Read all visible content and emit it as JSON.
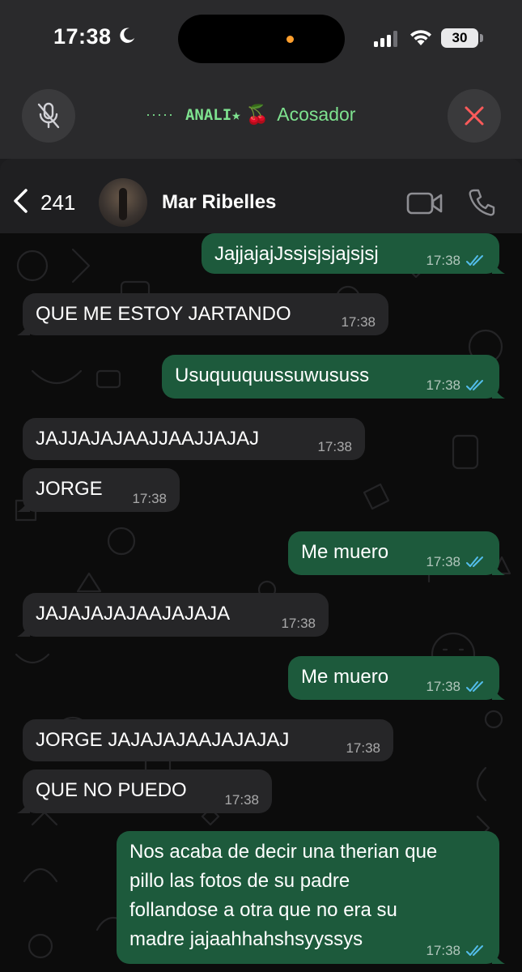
{
  "status_bar": {
    "time": "17:38",
    "battery": "30",
    "icons": [
      "moon-icon",
      "signal-icon",
      "wifi-icon",
      "battery-icon"
    ]
  },
  "call_bar": {
    "dots": "·····",
    "name_mono": "ANALI★",
    "name_emoji": "🍒",
    "name_rest": "Acosador",
    "accent_color": "#7ee28f",
    "end_color": "#ff5a5a"
  },
  "chat_header": {
    "unread_count": "241",
    "contact_name": "Mar Ribelles"
  },
  "colors": {
    "incoming_bubble": "#262628",
    "outgoing_bubble": "#1d5a3c",
    "read_ticks": "#53bdeb",
    "chat_background": "#0c0c0c"
  },
  "messages": [
    {
      "direction": "out",
      "text": "JajjajajJssjsjsjajsjsj",
      "time": "17:38"
    },
    {
      "direction": "in",
      "text": "QUE ME ESTOY JARTANDO",
      "time": "17:38"
    },
    {
      "direction": "out",
      "text": "Usuquuquussuwususs",
      "time": "17:38"
    },
    {
      "direction": "in",
      "text": "JAJJAJAJAAJJAAJJAJAJ",
      "time": "17:38"
    },
    {
      "direction": "in",
      "text": "JORGE",
      "time": "17:38"
    },
    {
      "direction": "out",
      "text": "Me muero",
      "time": "17:38"
    },
    {
      "direction": "in",
      "text": "JAJAJAJAJAAJAJAJA",
      "time": "17:38"
    },
    {
      "direction": "out",
      "text": "Me muero",
      "time": "17:38"
    },
    {
      "direction": "in",
      "text": "JORGE JAJAJAJAAJAJAJAJ",
      "time": "17:38"
    },
    {
      "direction": "in",
      "text": "QUE NO PUEDO",
      "time": "17:38"
    },
    {
      "direction": "out",
      "text": "Nos acaba de decir una therian que\npillo las fotos de su padre\nfollandose a otra que no era su\nmadre jajaahhahshsyyssys",
      "time": "17:38"
    }
  ]
}
